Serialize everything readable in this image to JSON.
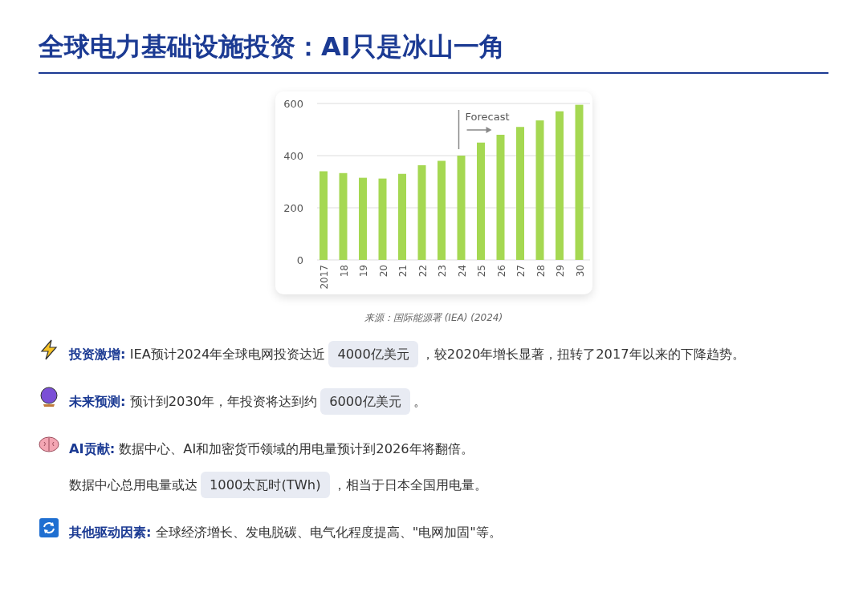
{
  "title": "全球电力基础设施投资：AI只是冰山一角",
  "chart": {
    "chart_data": {
      "type": "bar",
      "categories": [
        "2017",
        "18",
        "19",
        "20",
        "21",
        "22",
        "23",
        "24",
        "25",
        "26",
        "27",
        "28",
        "29",
        "30"
      ],
      "series": [
        {
          "color": "#a5d852",
          "values": [
            340,
            333,
            315,
            312,
            330,
            363,
            380,
            400,
            450,
            480,
            510,
            535,
            570,
            595
          ]
        }
      ],
      "ylim": [
        0,
        600
      ],
      "yticks": [
        0,
        200,
        400,
        600
      ],
      "annotations": [
        "Forecast"
      ]
    },
    "caption": "来源：国际能源署 (IEA) (2024)"
  },
  "items": [
    {
      "kind": "spark",
      "label": "投资激增:",
      "lines": [
        [
          {
            "kind": "text",
            "text": "IEA预计2024年全球电网投资达近"
          },
          {
            "kind": "highlight",
            "text": "4000亿美元"
          },
          {
            "kind": "text",
            "text": "，较2020年增长显著，扭转了2017年以来的下降趋势。"
          }
        ]
      ]
    },
    {
      "kind": "orb",
      "label": "未来预测:",
      "lines": [
        [
          {
            "kind": "text",
            "text": "预计到2030年，年投资将达到约"
          },
          {
            "kind": "highlight",
            "text": "6000亿美元"
          },
          {
            "kind": "text",
            "text": "。"
          }
        ]
      ]
    },
    {
      "kind": "brain",
      "label": "AI贡献:",
      "lines": [
        [
          {
            "kind": "text",
            "text": "数据中心、AI和加密货币领域的用电量预计到2026年将翻倍。"
          }
        ],
        [
          {
            "kind": "text",
            "text": "数据中心总用电量或达"
          },
          {
            "kind": "highlight",
            "text": "1000太瓦时(TWh)"
          },
          {
            "kind": "text",
            "text": "，相当于日本全国用电量。"
          }
        ]
      ]
    },
    {
      "kind": "cycle",
      "label": "其他驱动因素:",
      "lines": [
        [
          {
            "kind": "text",
            "text": "全球经济增长、发电脱碳、电气化程度提高、\"电网加固\"等。"
          }
        ]
      ]
    }
  ]
}
